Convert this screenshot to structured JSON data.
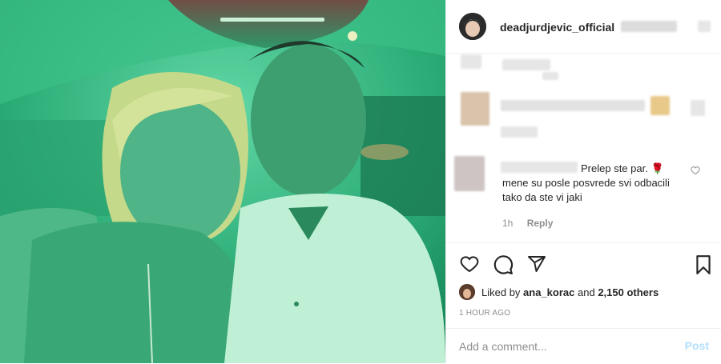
{
  "post": {
    "photo_icon": "selfie-photo",
    "accent_tint": "#1f9b6a"
  },
  "header": {
    "username": "deadjurdjevic_official"
  },
  "comments": {
    "third": {
      "text": "Prelep ste par. 🌹 mene su posle posvrede svi odbacili tako da ste vi jaki",
      "time": "1h",
      "reply_label": "Reply",
      "like_icon": "heart-outline-icon"
    }
  },
  "actions": {
    "like_icon": "heart-outline-icon",
    "comment_icon": "comment-bubble-icon",
    "share_icon": "paper-plane-icon",
    "save_icon": "bookmark-icon"
  },
  "likes": {
    "prefix": "Liked by",
    "user": "ana_korac",
    "conj": "and",
    "count_text": "2,150 others"
  },
  "timestamp": "1 HOUR AGO",
  "add_comment": {
    "placeholder": "Add a comment...",
    "post_label": "Post"
  }
}
